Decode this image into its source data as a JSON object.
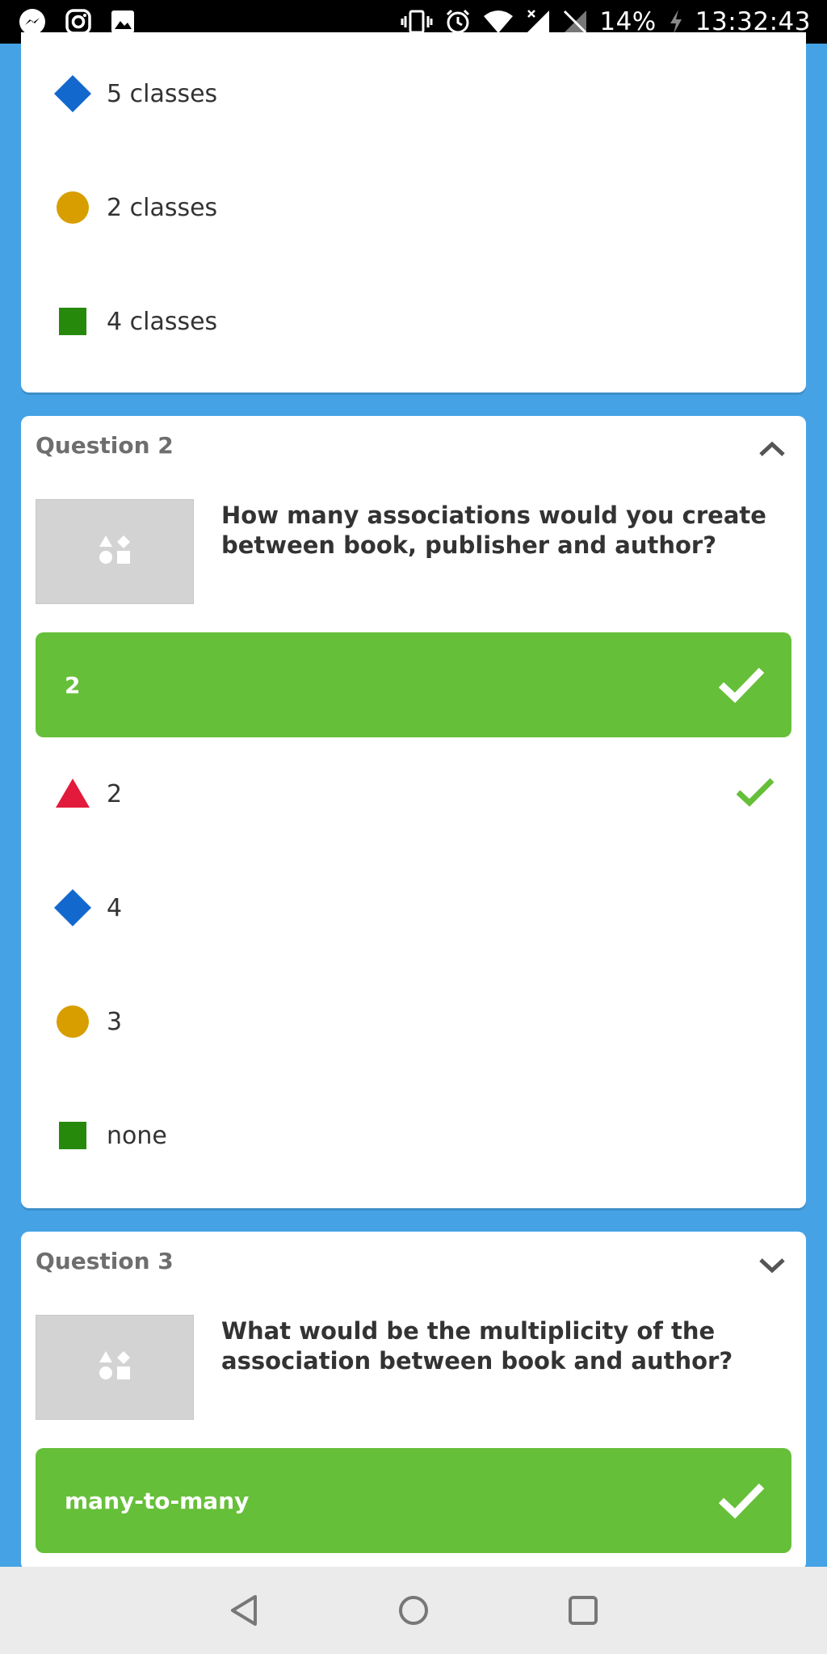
{
  "status_bar": {
    "battery": "14%",
    "time": "13:32:43",
    "icons": [
      "messenger-icon",
      "instagram-icon",
      "gallery-icon",
      "vibrate-icon",
      "alarm-icon",
      "wifi-icon",
      "signal-icon",
      "no-sim-icon",
      "charging-icon"
    ]
  },
  "card1": {
    "answers": [
      {
        "shape": "diamond",
        "color": "#1368ce",
        "text": "5 classes"
      },
      {
        "shape": "circle",
        "color": "#d89e00",
        "text": "2 classes"
      },
      {
        "shape": "square",
        "color": "#26890c",
        "text": "4 classes"
      }
    ]
  },
  "question2": {
    "label": "Question 2",
    "text": "How many associations would you create between book, publisher and author?",
    "correct_answer": "2",
    "answers": [
      {
        "shape": "triangle",
        "color": "#e21b3c",
        "text": "2",
        "correct": true
      },
      {
        "shape": "diamond",
        "color": "#1368ce",
        "text": "4",
        "correct": false
      },
      {
        "shape": "circle",
        "color": "#d89e00",
        "text": "3",
        "correct": false
      },
      {
        "shape": "square",
        "color": "#26890c",
        "text": "none",
        "correct": false
      }
    ]
  },
  "question3": {
    "label": "Question 3",
    "text": "What would be the multiplicity of the association between book and author?",
    "correct_answer": "many-to-many"
  },
  "colors": {
    "background": "#45a3e5",
    "correct": "#66bf39",
    "triangle": "#e21b3c",
    "diamond": "#1368ce",
    "circle": "#d89e00",
    "square": "#26890c"
  },
  "nav_bar": {
    "buttons": [
      "back-icon",
      "home-icon",
      "recents-icon"
    ]
  }
}
